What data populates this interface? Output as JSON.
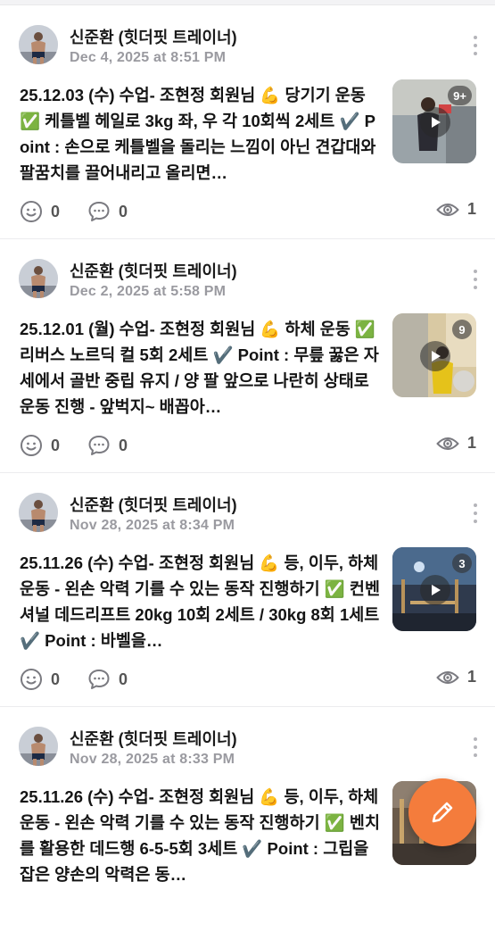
{
  "posts": [
    {
      "author": "신준환 (힛더핏 트레이너)",
      "timestamp": "Dec 4, 2025 at 8:51 PM",
      "content": "25.12.03 (수) 수업- 조현정 회원님 💪 당기기 운동 ✅ 케틀벨 헤일로 3kg 좌, 우 각 10회씩 2세트 ✔️ Point : 손으로 케틀벨을 돌리는 느낌이 아닌 견갑대와 팔꿈치를 끌어내리고 올리면…",
      "media_count": "9+",
      "reactions": "0",
      "comments": "0",
      "views": "1"
    },
    {
      "author": "신준환 (힛더핏 트레이너)",
      "timestamp": "Dec 2, 2025 at 5:58 PM",
      "content": "25.12.01 (월) 수업- 조현정 회원님 💪 하체 운동 ✅ 리버스 노르딕 컬 5회 2세트 ✔️ Point : 무릎 꿇은 자세에서 골반 중립 유지 / 양 팔 앞으로 나란히 상태로 운동 진행 - 앞벅지~ 배꼽아…",
      "media_count": "9",
      "reactions": "0",
      "comments": "0",
      "views": "1"
    },
    {
      "author": "신준환 (힛더핏 트레이너)",
      "timestamp": "Nov 28, 2025 at 8:34 PM",
      "content": "25.11.26 (수) 수업- 조현정 회원님 💪 등, 이두, 하체 운동 - 왼손 악력 기를 수 있는 동작 진행하기 ✅ 컨벤셔널 데드리프트 20kg 10회 2세트 / 30kg 8회 1세트 ✔️ Point : 바벨을…",
      "media_count": "3",
      "reactions": "0",
      "comments": "0",
      "views": "1"
    },
    {
      "author": "신준환 (힛더핏 트레이너)",
      "timestamp": "Nov 28, 2025 at 8:33 PM",
      "content": "25.11.26 (수) 수업- 조현정 회원님 💪 등, 이두, 하체 운동 - 왼손 악력 기를 수 있는 동작 진행하기 ✅ 벤치를 활용한 데드행 6-5-5회 3세트 ✔️ Point : 그립을 잡은 양손의 악력은 동…",
      "media_count": "",
      "reactions": "",
      "comments": "",
      "views": ""
    }
  ],
  "fab": {
    "icon": "pencil-icon",
    "color": "#f47c3c"
  }
}
